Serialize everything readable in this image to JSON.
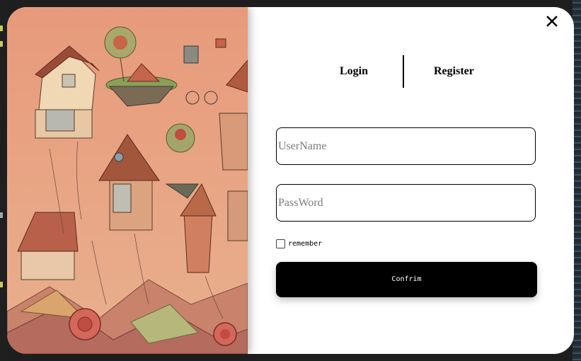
{
  "dialog": {
    "close_icon": "close-icon",
    "tabs": [
      {
        "label": "Login",
        "active": true
      },
      {
        "label": "Register",
        "active": false
      }
    ],
    "username": {
      "value": "",
      "placeholder": "UserName"
    },
    "password": {
      "value": "",
      "placeholder": "PassWord"
    },
    "remember_label": "remember",
    "remember_checked": false,
    "confirm_label": "Confrim"
  },
  "colors": {
    "art_background": "#e7a483",
    "button_background": "#000000",
    "dialog_background": "#ffffff"
  }
}
